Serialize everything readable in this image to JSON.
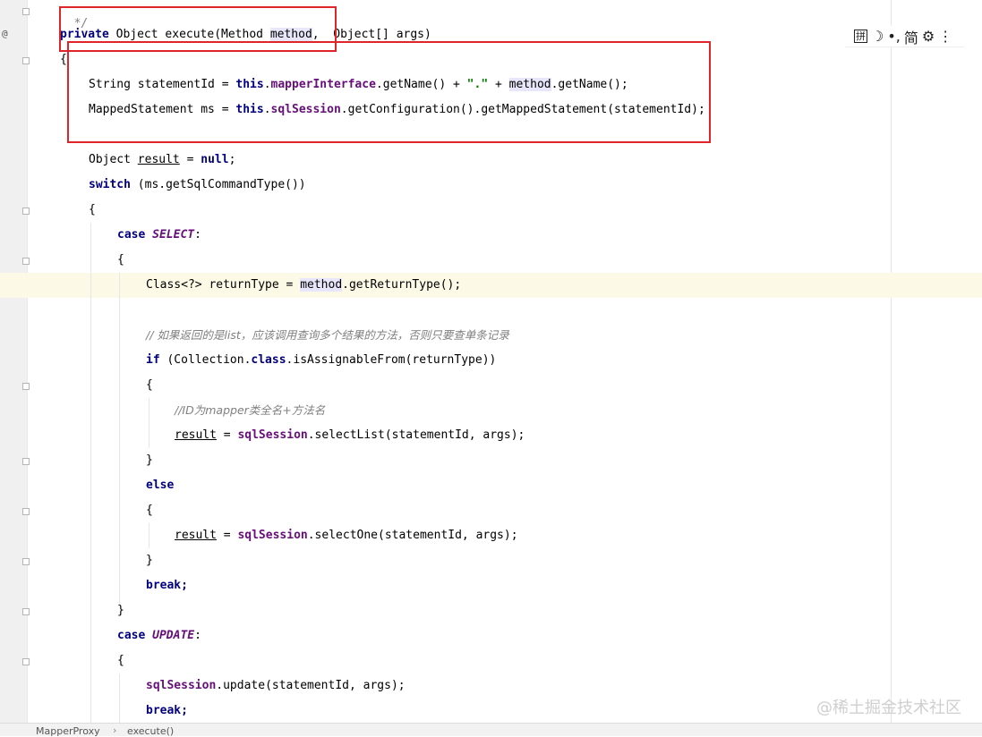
{
  "gutter": {
    "annotation_marker": "@"
  },
  "code": {
    "line_comment_end": "*/",
    "signature": {
      "private": "private",
      "obj": " Object execute(Method ",
      "method": "method",
      "comma": ",",
      "rest": "  Object[] args)"
    },
    "open_brace_1": "{",
    "stmt_id": {
      "a": "String statementId = ",
      "this": "this",
      "dot1": ".",
      "field": "mapperInterface",
      "b": ".getName() + ",
      "str": "\".\"",
      "c": " + ",
      "method": "method",
      "d": ".getName();"
    },
    "mapped": {
      "a": "MappedStatement ms = ",
      "this": "this",
      "dot1": ".",
      "field": "sqlSession",
      "b": ".getConfiguration().getMappedStatement(statementId);"
    },
    "result_decl": {
      "a": "Object ",
      "result": "result",
      "b": " = ",
      "null": "null",
      "c": ";"
    },
    "switch": {
      "kw": "switch",
      "rest": " (ms.getSqlCommandType())"
    },
    "open_brace_2": "{",
    "case_select": {
      "kw": "case",
      "enum": "SELECT",
      "colon": ":"
    },
    "open_brace_3": "{",
    "return_type": {
      "a": "Class<?> returnType = ",
      "method": "method",
      "b": ".getReturnType();"
    },
    "comment_list": "// 如果返回的是list，应该调用查询多个结果的方法，否则只要查单条记录",
    "if_line": {
      "kw": "if",
      "a": " (Collection.",
      "class": "class",
      "b": ".isAssignableFrom(returnType))"
    },
    "open_brace_4": "{",
    "comment_id": "//ID为mapper类全名+方法名",
    "select_list": {
      "result": "result",
      "a": " = ",
      "field": "sqlSession",
      "b": ".selectList(statementId, args);"
    },
    "close_brace_4": "}",
    "else_kw": "else",
    "open_brace_5": "{",
    "select_one": {
      "result": "result",
      "a": " = ",
      "field": "sqlSession",
      "b": ".selectOne(statementId, args);"
    },
    "close_brace_5": "}",
    "break_1": "break;",
    "close_brace_3": "}",
    "case_update": {
      "kw": "case",
      "enum": "UPDATE",
      "colon": ":"
    },
    "open_brace_6": "{",
    "update_call": {
      "field": "sqlSession",
      "b": ".update(statementId, args);"
    },
    "break_2": "break;"
  },
  "ime_toolbar": {
    "pinyin": "拼",
    "moon": "☽",
    "punct": "•,",
    "simplified": "简",
    "gear": "⚙",
    "more": "⋮"
  },
  "watermark": "@稀土掘金技术社区",
  "status_bar": {
    "crumb_class": "MapperProxy",
    "crumb_method": "execute()"
  },
  "colors": {
    "keyword": "#000080",
    "field": "#660e7a",
    "string": "#008000",
    "comment": "#808080",
    "highlight": "#e0252a"
  }
}
